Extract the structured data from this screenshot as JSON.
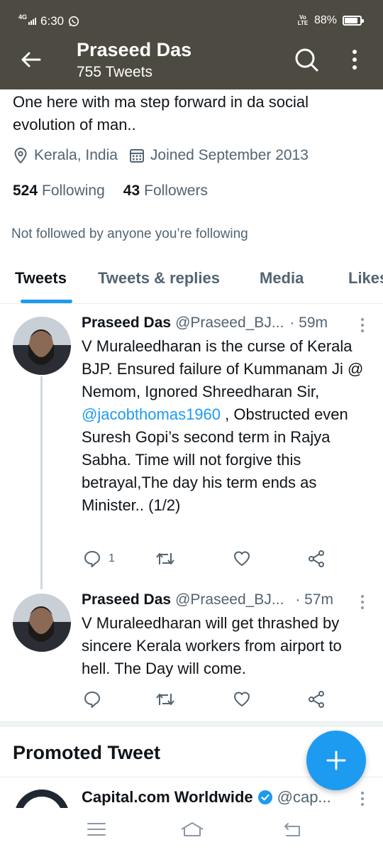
{
  "status_bar": {
    "network": "4G",
    "time": "6:30",
    "volte": "Vo LTE",
    "battery": "88%",
    "battery_level": 0.88
  },
  "header": {
    "title": "Praseed Das",
    "subtitle": "755 Tweets"
  },
  "profile": {
    "bio": "One here with ma step forward in da social evolution of man..",
    "location": "Kerala, India",
    "joined": "Joined September 2013",
    "following_count": "524",
    "following_label": "Following",
    "followers_count": "43",
    "followers_label": "Followers",
    "not_followed": "Not followed by anyone you’re following"
  },
  "tabs": [
    {
      "label": "Tweets"
    },
    {
      "label": "Tweets & replies"
    },
    {
      "label": "Media"
    },
    {
      "label": "Likes"
    }
  ],
  "tweets": [
    {
      "name": "Praseed Das",
      "handle": "@Praseed_BJ...",
      "time": "· 59m",
      "text_before": "V Muraleedharan  is the curse of Kerala BJP. Ensured failure of Kummanam Ji @ Nemom, Ignored Shreedharan Sir, ",
      "mention": "@jacobthomas1960",
      "text_after": " , Obstructed even Suresh Gopi’s second term in Rajya Sabha. Time will not forgive this betrayal,The day his term ends as Minister.. (1/2)",
      "reply_count": "1"
    },
    {
      "name": "Praseed Das",
      "handle": "@Praseed_BJ...",
      "time": "· 57m",
      "text": "V Muraleedharan will get thrashed by sincere Kerala workers from airport to hell. The Day will come.",
      "reply_count": ""
    }
  ],
  "promoted": {
    "heading": "Promoted Tweet",
    "name": "Capital.com Worldwide",
    "handle": "@cap..."
  },
  "colors": {
    "header_bg": "#4d4a41",
    "accent": "#1d9bf0",
    "secondary_text": "#536471"
  },
  "icons": [
    "back-arrow-icon",
    "search-icon",
    "more-vertical-icon",
    "location-pin-icon",
    "calendar-icon",
    "reply-icon",
    "retweet-icon",
    "like-icon",
    "share-icon",
    "compose-plus-icon",
    "verified-badge-icon",
    "menu-lines-icon",
    "home-outline-icon",
    "back-nav-icon"
  ]
}
